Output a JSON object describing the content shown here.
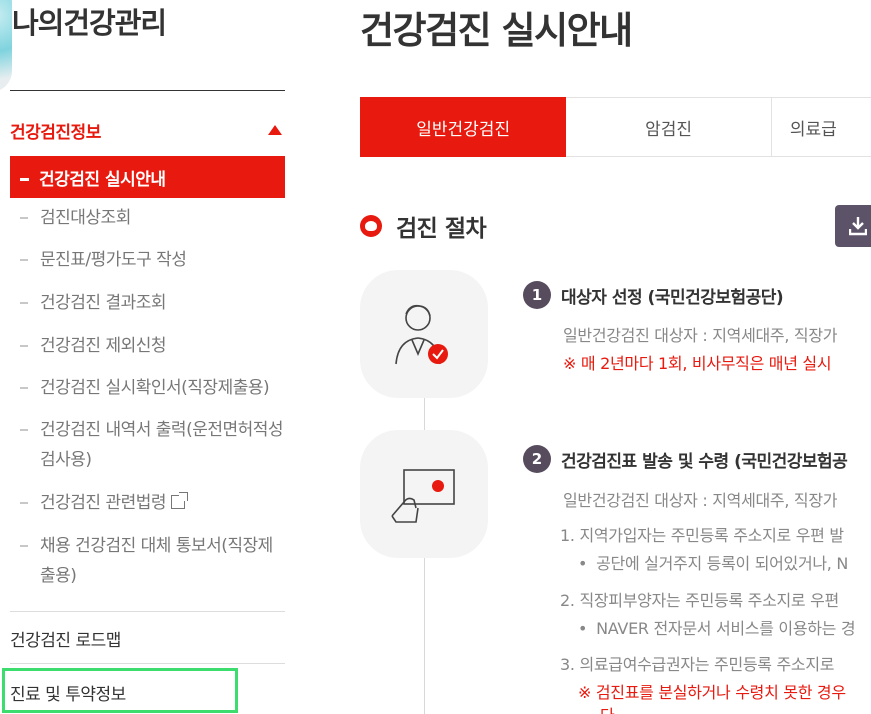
{
  "sidebar": {
    "title": "나의건강관리",
    "group": {
      "label": "건강검진정보"
    },
    "active_item": "건강검진 실시안내",
    "items": [
      {
        "label": "검진대상조회"
      },
      {
        "label": "문진표/평가도구 작성"
      },
      {
        "label": "건강검진 결과조회"
      },
      {
        "label": "건강검진 제외신청"
      },
      {
        "label": "건강검진 실시확인서(직장제출용)"
      },
      {
        "label": "건강검진 내역서 출력(운전면허적성",
        "label2": "검사용)"
      },
      {
        "label": "건강검진 관련법령"
      },
      {
        "label": "채용 건강검진 대체 통보서(직장제",
        "label2": "출용)"
      }
    ],
    "links": [
      {
        "label": "건강검진 로드맵"
      },
      {
        "label": "진료 및 투약정보"
      }
    ]
  },
  "main": {
    "title": "건강검진 실시안내",
    "tabs": [
      {
        "label": "일반건강검진"
      },
      {
        "label": "암검진"
      },
      {
        "label": "의료급"
      }
    ],
    "section_title": "검진 절차",
    "steps": [
      {
        "num": "1",
        "title": "대상자 선정 (국민건강보험공단)",
        "lines": [
          "일반건강검진 대상자 : 지역세대주, 직장가",
          "※ 매 2년마다 1회, 비사무직은 매년 실시"
        ]
      },
      {
        "num": "2",
        "title": "건강검진표 발송 및 수령 (국민건강보험공",
        "lines": [
          "일반건강검진 대상자 : 지역세대주, 직장가",
          "1. 지역가입자는 주민등록 주소지로 우편 발",
          "공단에 실거주지 등록이 되어있거나, N",
          "2. 직장피부양자는 주민등록 주소지로 우편",
          "NAVER 전자문서 서비스를 이용하는 경",
          "3. 의료급여수급권자는 주민등록 주소지로",
          "※ 검진표를 분실하거나 수령치 못한 경우",
          "다"
        ]
      }
    ]
  },
  "colors": {
    "accent": "#e8190e",
    "step_badge": "#574c5e",
    "download_btn": "#5d5368",
    "focus_outline": "#3ddc6e"
  },
  "icons": [
    "caret-up-icon",
    "external-link-icon",
    "heart-bullet-icon",
    "download-icon",
    "doctor-check-icon",
    "card-hand-icon"
  ]
}
